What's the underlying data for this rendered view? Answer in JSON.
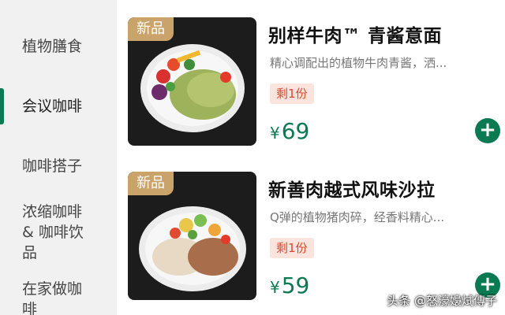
{
  "sidebar": {
    "items": [
      {
        "label": "植物膳食"
      },
      {
        "label": "会议咖啡"
      },
      {
        "label": "咖啡搭子"
      },
      {
        "label": "浓缩咖啡& 咖啡饮品"
      },
      {
        "label": "在家做咖啡"
      }
    ],
    "active_index": 1
  },
  "products": [
    {
      "badge": "新品",
      "name": "别样牛肉™ 青酱意面",
      "description": "精心调配出的植物牛肉青酱，洒...",
      "stock": "剩1份",
      "currency": "¥",
      "price": "69",
      "image_icon": "pasta-dish-image"
    },
    {
      "badge": "新品",
      "name": "新善肉越式风味沙拉",
      "description": "Q弹的植物猪肉碎，经香料精心...",
      "stock": "剩1份",
      "currency": "¥",
      "price": "59",
      "image_icon": "salad-dish-image"
    }
  ],
  "add_button": {
    "symbol": "+",
    "icon": "plus-icon"
  },
  "watermark": "头条 @怒濠嬝烒傳子",
  "colors": {
    "accent": "#0a7a52",
    "badge": "#c9a36a",
    "stock_bg": "#fbe4de",
    "stock_text": "#d9482b"
  }
}
